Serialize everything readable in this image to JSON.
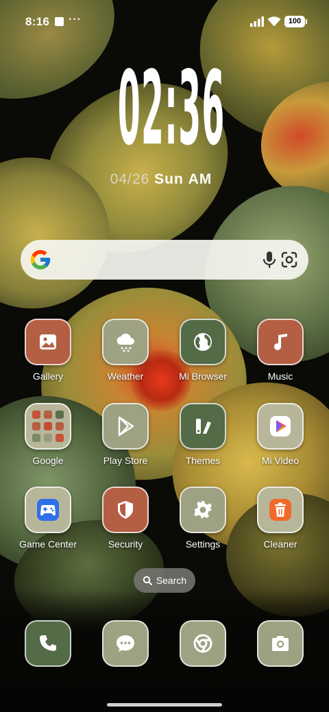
{
  "status_bar": {
    "time": "8:16",
    "more": "···",
    "battery": "100"
  },
  "clock": {
    "time": "02:36",
    "date": "04/26",
    "weekday": "Sun",
    "meridiem": "AM"
  },
  "search_bar": {
    "google_icon": "google-g-icon",
    "mic_icon": "mic-icon",
    "lens_icon": "google-lens-icon"
  },
  "apps": [
    {
      "label": "Gallery",
      "icon": "gallery-icon",
      "color": "#b45e44"
    },
    {
      "label": "Weather",
      "icon": "weather-icon",
      "color": "#9ea182"
    },
    {
      "label": "Mi Browser",
      "icon": "globe-icon",
      "color": "#536b46"
    },
    {
      "label": "Music",
      "icon": "music-note-icon",
      "color": "#b45e44"
    },
    {
      "label": "Google",
      "icon": "folder-icon",
      "color": "#b7b69a"
    },
    {
      "label": "Play Store",
      "icon": "play-store-icon",
      "color": "#9ea182"
    },
    {
      "label": "Themes",
      "icon": "themes-icon",
      "color": "#536b46"
    },
    {
      "label": "Mi Video",
      "icon": "mi-video-icon",
      "color": "#b7b69a"
    },
    {
      "label": "Game Center",
      "icon": "gamepad-icon",
      "color": "#b7b69a"
    },
    {
      "label": "Security",
      "icon": "shield-icon",
      "color": "#b45e44"
    },
    {
      "label": "Settings",
      "icon": "gear-icon",
      "color": "#9ea182"
    },
    {
      "label": "Cleaner",
      "icon": "trash-icon",
      "color": "#b7b69a"
    }
  ],
  "search_pill": {
    "label": "Search"
  },
  "dock": [
    {
      "icon": "phone-icon",
      "color": "#536b46"
    },
    {
      "icon": "messages-icon",
      "color": "#9ea182"
    },
    {
      "icon": "chrome-icon",
      "color": "#9ea182"
    },
    {
      "icon": "camera-icon",
      "color": "#9ea182"
    }
  ]
}
